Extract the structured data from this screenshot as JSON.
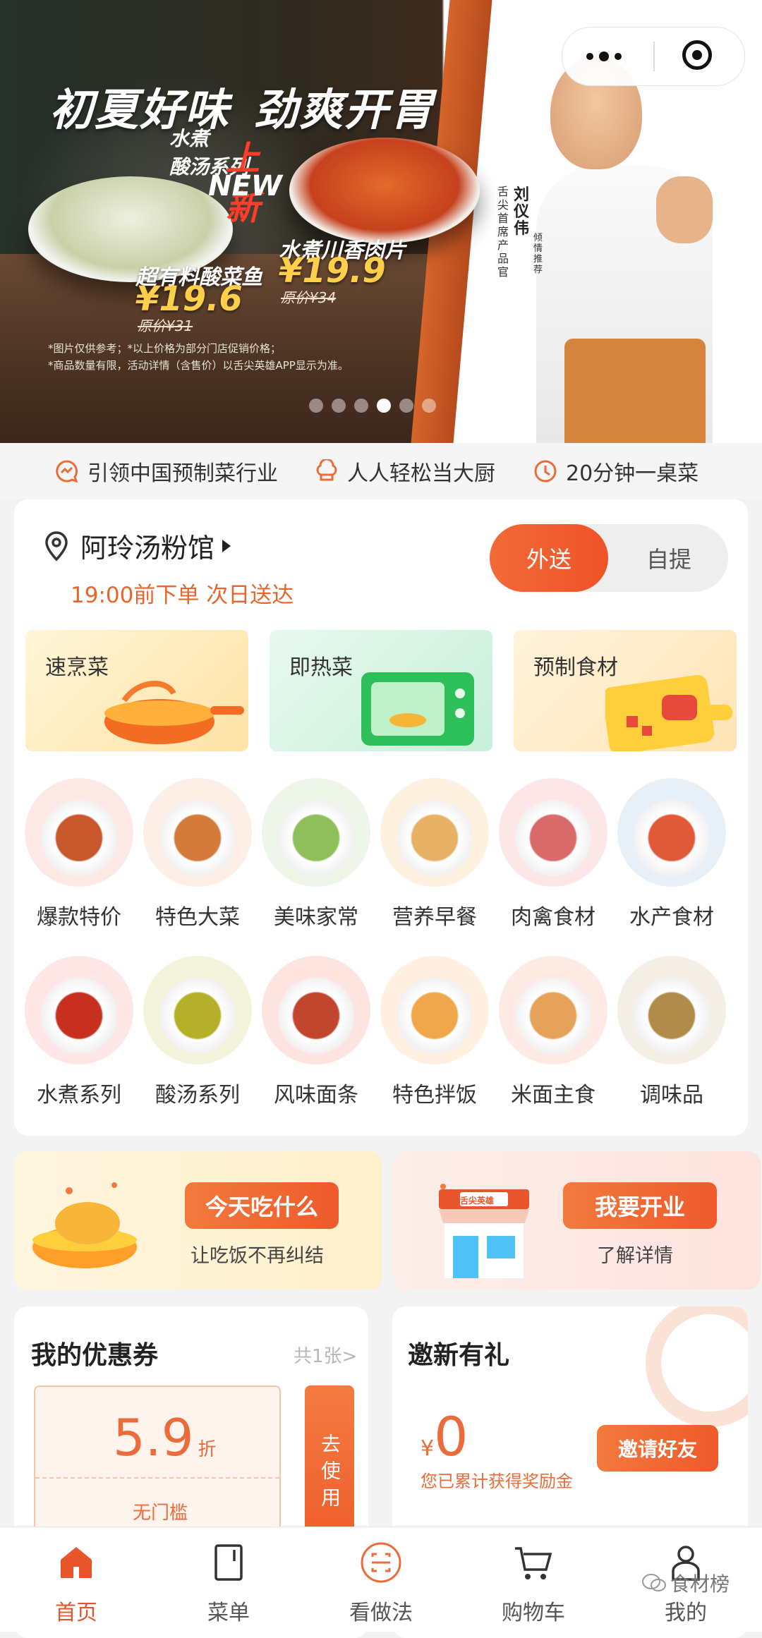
{
  "banner": {
    "title_left": "初夏好味",
    "title_right": "劲爽开胃",
    "new_line1": "水煮",
    "new_line2": "酸汤系列",
    "new_badge": "上新",
    "new_en": "NEW",
    "dish1_name": "超有料酸菜鱼",
    "dish1_price": "¥19.6",
    "dish1_orig": "原价¥31",
    "dish2_name": "水煮川香肉片",
    "dish2_price": "¥19.9",
    "dish2_orig": "原价¥34",
    "note1": "*图片仅供参考；*以上价格为部分门店促销价格；",
    "note2": "*商品数量有限，活动详情（含售价）以舌尖英雄APP显示为准。",
    "person_name": "刘仪伟",
    "person_title": "舌尖首席产品官",
    "person_sub": "倾情推荐",
    "dots_count": 6,
    "active_dot": 3
  },
  "features": [
    {
      "icon": "chat-icon",
      "label": "引领中国预制菜行业"
    },
    {
      "icon": "chef-hat-icon",
      "label": "人人轻松当大厨"
    },
    {
      "icon": "clock-icon",
      "label": "20分钟一桌菜"
    }
  ],
  "store": {
    "name": "阿玲汤粉馆",
    "subtitle": "19:00前下单 次日送达",
    "mode_delivery": "外送",
    "mode_pickup": "自提",
    "active_mode": "外送"
  },
  "category_tiles": [
    {
      "label": "速烹菜",
      "icon": "wok-icon"
    },
    {
      "label": "即热菜",
      "icon": "microwave-icon"
    },
    {
      "label": "预制食材",
      "icon": "cutting-board-icon"
    }
  ],
  "categories": [
    {
      "label": "爆款特价"
    },
    {
      "label": "特色大菜"
    },
    {
      "label": "美味家常"
    },
    {
      "label": "营养早餐"
    },
    {
      "label": "肉禽食材"
    },
    {
      "label": "水产食材"
    },
    {
      "label": "水煮系列"
    },
    {
      "label": "酸汤系列"
    },
    {
      "label": "风味面条"
    },
    {
      "label": "特色拌饭"
    },
    {
      "label": "米面主食"
    },
    {
      "label": "调味品"
    }
  ],
  "promos": {
    "left_button": "今天吃什么",
    "left_sub": "让吃饭不再纠结",
    "right_button": "我要开业",
    "right_sub": "了解详情",
    "shop_sign": "舌尖英雄"
  },
  "coupons": {
    "title": "我的优惠券",
    "count": "共1张>",
    "discount": "5.9",
    "discount_unit": "折",
    "condition": "无门槛",
    "use_label": "去使用"
  },
  "invite": {
    "title": "邀新有礼",
    "currency": "¥",
    "amount": "0",
    "desc": "您已累计获得奖励金",
    "button": "邀请好友"
  },
  "tabs": [
    {
      "label": "首页",
      "icon": "home-icon",
      "active": true
    },
    {
      "label": "菜单",
      "icon": "menu-book-icon",
      "active": false
    },
    {
      "label": "看做法",
      "icon": "scan-icon",
      "active": false
    },
    {
      "label": "购物车",
      "icon": "cart-icon",
      "active": false
    },
    {
      "label": "我的",
      "icon": "user-icon",
      "active": false
    }
  ],
  "watermark": "食材榜",
  "colors": {
    "accent": "#ee5a2b",
    "accent_light": "#f27a3e",
    "banner_price": "#ffcf4a"
  }
}
